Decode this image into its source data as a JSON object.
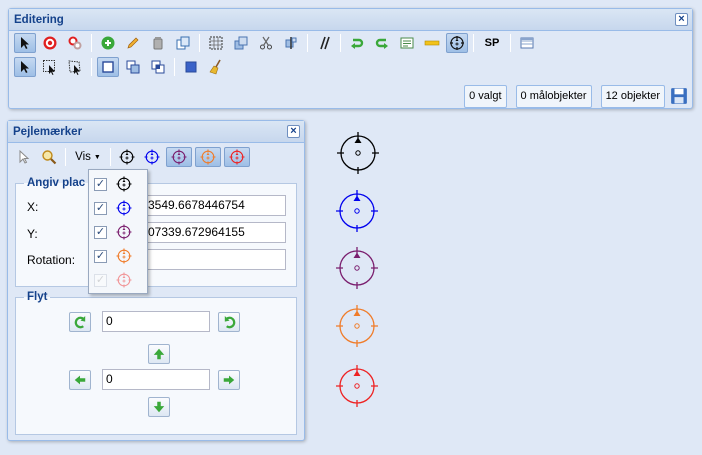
{
  "colors": {
    "black": "#000000",
    "blue": "#0000ee",
    "purple": "#7a1e6e",
    "orange": "#f07c2a",
    "red": "#ee2222",
    "header_text": "#15428b"
  },
  "editing": {
    "title": "Editering",
    "sp_label": "SP",
    "status": {
      "selected": "0 valgt",
      "targets": "0 målobjekter",
      "objects": "12 objekter"
    }
  },
  "bearings": {
    "title": "Pejlemærker",
    "vis_label": "Vis",
    "placement": {
      "legend": "Angiv plac",
      "x_label": "X:",
      "x_value": "3549.6678446754",
      "y_label": "Y:",
      "y_value": "07339.672964155",
      "rotation_label": "Rotation:",
      "rotation_value": ""
    },
    "move": {
      "legend": "Flyt",
      "rotate_value": "0",
      "shift_value": "0"
    },
    "dropdown": [
      {
        "icon": "black-marker-icon",
        "color": "#000000",
        "checked": true,
        "enabled": true
      },
      {
        "icon": "blue-marker-icon",
        "color": "#0000ee",
        "checked": true,
        "enabled": true
      },
      {
        "icon": "purple-marker-icon",
        "color": "#7a1e6e",
        "checked": true,
        "enabled": true
      },
      {
        "icon": "orange-marker-icon",
        "color": "#f07c2a",
        "checked": true,
        "enabled": true
      },
      {
        "icon": "red-marker-icon",
        "color": "#ee2222",
        "checked": true,
        "enabled": false
      }
    ]
  }
}
